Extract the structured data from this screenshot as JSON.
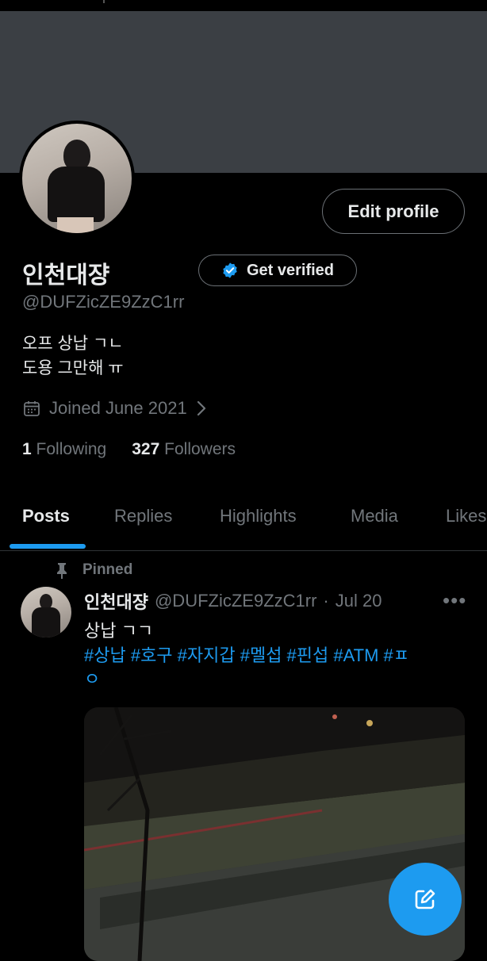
{
  "profile": {
    "edit_label": "Edit profile",
    "name": "인천대쟝",
    "verify_label": "Get verified",
    "handle": "@DUFZicZE9ZzC1rr",
    "bio_line1": "오프 상납 ㄱㄴ",
    "bio_line2": "도용 그만해 ㅠ",
    "joined": "Joined June 2021",
    "following_count": "1",
    "following_label": "Following",
    "followers_count": "327",
    "followers_label": "Followers"
  },
  "tabs": [
    "Posts",
    "Replies",
    "Highlights",
    "Media",
    "Likes"
  ],
  "active_tab": "Posts",
  "post": {
    "pinned_label": "Pinned",
    "author_name": "인천대쟝",
    "author_handle": "@DUFZicZE9ZzC1rr",
    "separator": "·",
    "date": "Jul 20",
    "text": "상납 ㄱㄱ",
    "hashtags_line1": "#상납 #호구 #자지갑 #멜섭 #핀섭 #ATM #ㅍ",
    "hashtags_line2": "ㅇ"
  },
  "colors": {
    "background": "#000000",
    "banner": "#3b3f44",
    "accent": "#1d9bf0",
    "muted": "#71767b",
    "text": "#e7e9ea"
  },
  "icons": [
    "calendar-icon",
    "chevron-right-icon",
    "verified-badge-icon",
    "pin-icon",
    "more-icon",
    "compose-icon"
  ]
}
